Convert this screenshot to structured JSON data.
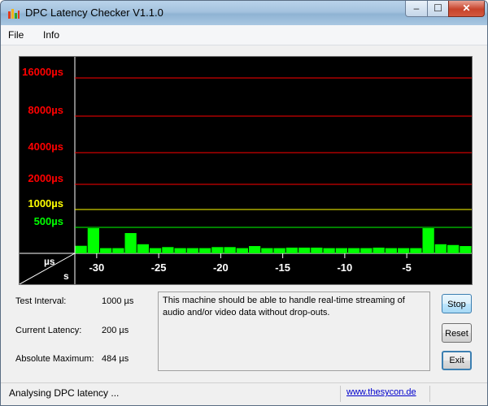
{
  "window": {
    "title": "DPC Latency Checker V1.1.0",
    "close_glyph": "✕",
    "min_glyph": "–",
    "max_glyph": "☐"
  },
  "menu": {
    "items": [
      "File",
      "Info"
    ]
  },
  "chart_data": {
    "type": "bar",
    "title": "",
    "xlabel": "s",
    "ylabel": "µs",
    "y_axis_labels": [
      {
        "label": "16000µs",
        "value": 16000,
        "color": "#ff0000"
      },
      {
        "label": "8000µs",
        "value": 8000,
        "color": "#ff0000"
      },
      {
        "label": "4000µs",
        "value": 4000,
        "color": "#ff0000"
      },
      {
        "label": "2000µs",
        "value": 2000,
        "color": "#ff0000"
      },
      {
        "label": "1000µs",
        "value": 1000,
        "color": "#ffff00"
      },
      {
        "label": "500µs",
        "value": 500,
        "color": "#00ff00"
      }
    ],
    "x_ticks": [
      -30,
      -25,
      -20,
      -15,
      -10,
      -5
    ],
    "x_range": [
      -32,
      0
    ],
    "bar_color": "#00ff00",
    "values": [
      145,
      484,
      100,
      100,
      390,
      175,
      100,
      120,
      100,
      100,
      100,
      120,
      120,
      100,
      140,
      100,
      100,
      110,
      110,
      110,
      100,
      100,
      100,
      100,
      110,
      100,
      100,
      100,
      484,
      175,
      160,
      140
    ]
  },
  "stats": {
    "test_interval_label": "Test Interval:",
    "test_interval_value": "1000 µs",
    "current_latency_label": "Current Latency:",
    "current_latency_value": "200 µs",
    "absolute_max_label": "Absolute Maximum:",
    "absolute_max_value": "484 µs"
  },
  "message": "This machine should be able to handle real-time streaming of audio and/or video data without drop-outs.",
  "buttons": {
    "stop": "Stop",
    "reset": "Reset",
    "exit": "Exit"
  },
  "status": {
    "text": "Analysing DPC latency ...",
    "link": "www.thesycon.de"
  }
}
